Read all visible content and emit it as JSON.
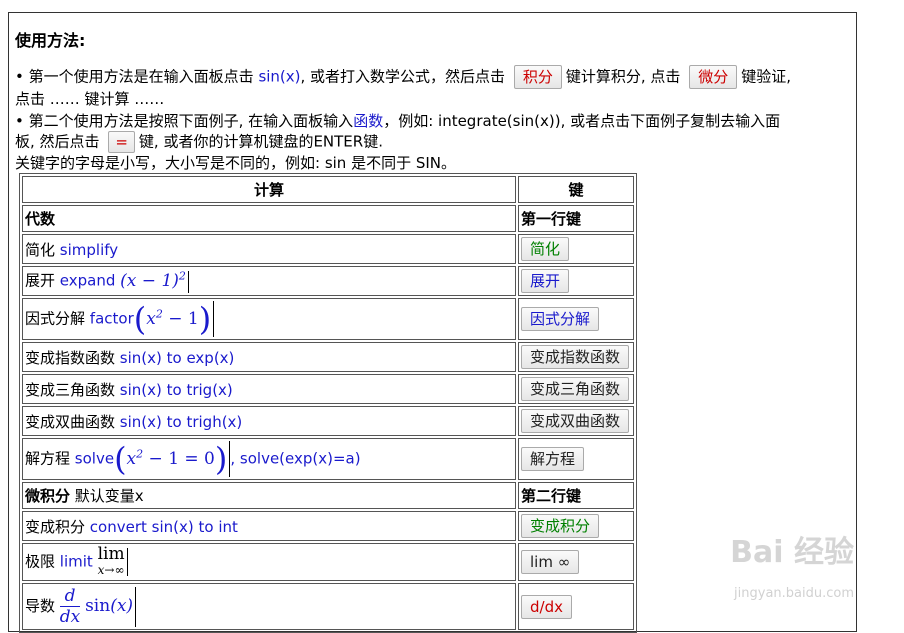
{
  "heading": "使用方法:",
  "para1": {
    "bullet": "•",
    "t1": "第一个使用方法是在输入面板点击",
    "link1": "sin(x)",
    "t2": ", 或者打入数学公式，然后点击",
    "btn_integral": "积分",
    "t3": "键计算积分, 点击",
    "btn_derivative": "微分",
    "t4": "键验证,",
    "t5": "点击 …… 键计算 ……"
  },
  "para2": {
    "bullet": "•",
    "t1": "第二个使用方法是按照下面例子, 在输入面板输入",
    "link1": "函数",
    "t2": "，例如: integrate(sin(x)), 或者点击下面例子复制去输入面",
    "t3": "板, 然后点击",
    "btn_equal": "=",
    "t4": "键, 或者你的计算机键盘的ENTER键."
  },
  "para3": "关键字的字母是小写，大小写是不同的，例如: sin 是不同于 SIN。",
  "table": {
    "header_calc": "计算",
    "header_key": "键",
    "sections": {
      "algebra": "代数",
      "algebra_key": "第一行键",
      "calculus": "微积分",
      "calculus_note": "默认变量x",
      "calculus_key": "第二行键"
    },
    "rows": [
      {
        "label": "简化",
        "cmd": "simplify",
        "btn": "简化"
      },
      {
        "label": "展开",
        "cmd": "expand",
        "btn": "展开"
      },
      {
        "label": "因式分解",
        "cmd": "factor",
        "btn": "因式分解"
      },
      {
        "label": "变成指数函数",
        "cmd": "sin(x) to exp(x)",
        "btn": "变成指数函数"
      },
      {
        "label": "变成三角函数",
        "cmd": "sin(x) to trig(x)",
        "btn": "变成三角函数"
      },
      {
        "label": "变成双曲函数",
        "cmd": "sin(x) to trigh(x)",
        "btn": "变成双曲函数"
      },
      {
        "label": "解方程",
        "cmd": "solve",
        "cmd2": ", solve(exp(x)=a)",
        "btn": "解方程"
      },
      {
        "label": "变成积分",
        "cmd": "convert sin(x) to int",
        "btn": "变成积分"
      },
      {
        "label": "极限",
        "cmd": "limit",
        "btn": "lim ∞"
      },
      {
        "label": "导数",
        "cmd": "",
        "btn": "d/dx"
      }
    ]
  },
  "math": {
    "expand_expr": "(x − 1)",
    "expand_pow": "2",
    "factor_expr": "x",
    "factor_pow": "2",
    "factor_rest": " − 1",
    "solve_expr": "x",
    "solve_pow": "2",
    "solve_rest": " − 1 = 0",
    "lim_word": "lim",
    "lim_sub": "x→∞",
    "deriv_num": "d",
    "deriv_den": "dx",
    "deriv_fn": "sin",
    "deriv_arg": "(x)"
  },
  "watermark": {
    "brand": "Bai 经验",
    "url": "jingyan.baidu.com"
  },
  "colors": {
    "link_blue": "#1a1acc",
    "btn_red": "#cc0000",
    "btn_green": "#008000"
  }
}
